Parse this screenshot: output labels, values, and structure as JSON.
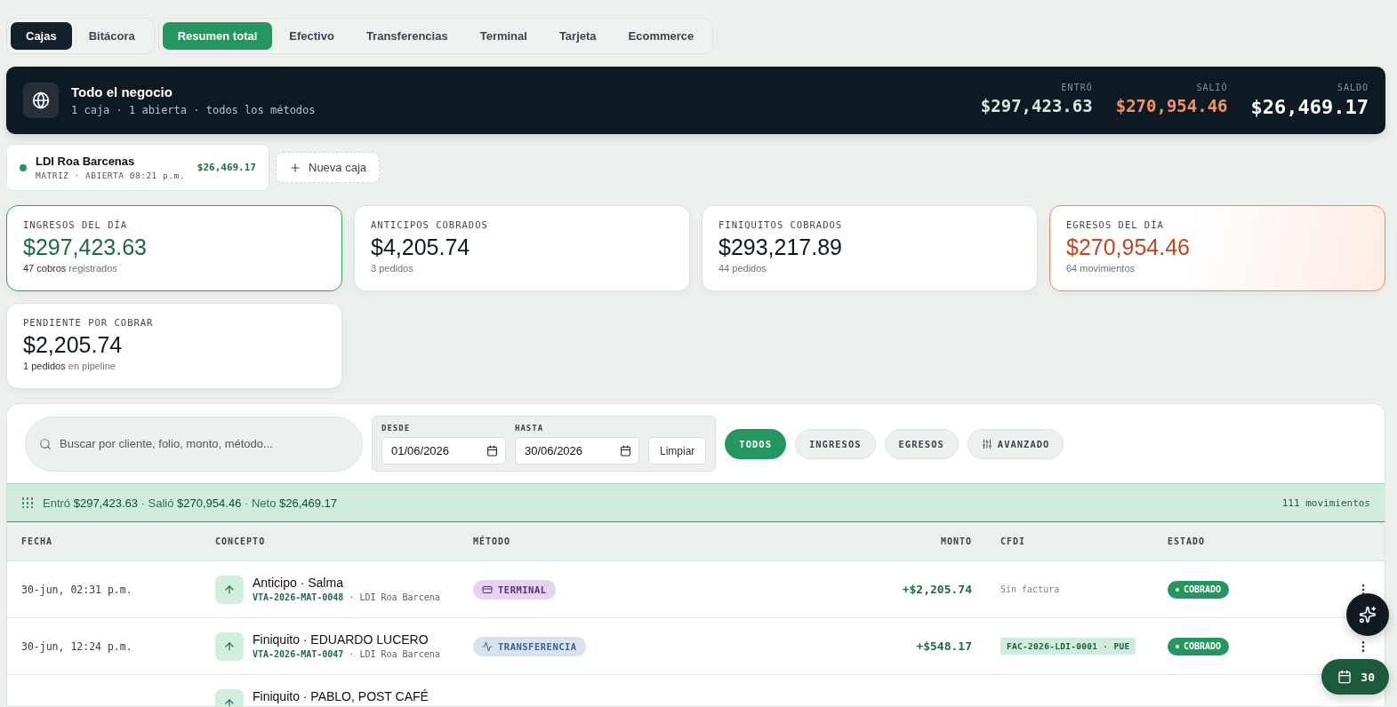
{
  "view_tabs": [
    {
      "label": "Cajas",
      "selected": true
    },
    {
      "label": "Bitácora",
      "selected": false
    }
  ],
  "method_tabs": [
    {
      "label": "Resumen total",
      "selected": true
    },
    {
      "label": "Efectivo",
      "selected": false
    },
    {
      "label": "Transferencias",
      "selected": false
    },
    {
      "label": "Terminal",
      "selected": false
    },
    {
      "label": "Tarjeta",
      "selected": false
    },
    {
      "label": "Ecommerce",
      "selected": false
    }
  ],
  "summary_banner": {
    "title": "Todo el negocio",
    "subtitle": "1 caja · 1 abierta · todos los métodos",
    "totals": [
      {
        "label": "ENTRÓ",
        "value": "$297,423.63",
        "kind": "in"
      },
      {
        "label": "SALIÓ",
        "value": "$270,954.46",
        "kind": "out"
      },
      {
        "label": "SALDO",
        "value": "$26,469.17",
        "kind": "balance"
      }
    ]
  },
  "registers": [
    {
      "name": "LDI Roa Barcenas",
      "meta": "MATRIZ · ABIERTA 08:21 p.m.",
      "amount": "$26,469.17",
      "open": true
    }
  ],
  "new_register_button": "Nueva caja",
  "stat_cards": [
    {
      "label": "INGRESOS DEL DÍA",
      "value": "$297,423.63",
      "detail": "**47 cobros** registrados",
      "kind": "income"
    },
    {
      "label": "ANTICIPOS COBRADOS",
      "value": "$4,205.74",
      "detail": "3 pedidos",
      "kind": "plain"
    },
    {
      "label": "FINIQUITOS COBRADOS",
      "value": "$293,217.89",
      "detail": "44 pedidos",
      "kind": "plain"
    },
    {
      "label": "EGRESOS DEL DÍA",
      "value": "$270,954.46",
      "detail": "64 movimientos",
      "kind": "expense"
    },
    {
      "label": "PENDIENTE POR COBRAR",
      "value": "$2,205.74",
      "detail": "**1 pedidos** en pipeline",
      "kind": "plain"
    }
  ],
  "filters": {
    "search_placeholder": "Buscar por cliente, folio, monto, método...",
    "date_from": {
      "label": "DESDE",
      "value": "01/06/2026"
    },
    "date_to": {
      "label": "HASTA",
      "value": "30/06/2026"
    },
    "clear_button": "Limpiar",
    "type_chips": [
      {
        "label": "TODOS",
        "selected": true,
        "kind": "plain"
      },
      {
        "label": "INGRESOS",
        "selected": false,
        "kind": "plain"
      },
      {
        "label": "EGRESOS",
        "selected": false,
        "kind": "plain"
      },
      {
        "label": "AVANZADO",
        "selected": false,
        "kind": "advanced"
      }
    ]
  },
  "totals_bar": {
    "text": "Entró **$297,423.63** · Salió **$270,954.46** · Neto **$26,469.17**",
    "count": "111 movimientos"
  },
  "table": {
    "columns": [
      "FECHA",
      "CONCEPTO",
      "MÉTODO",
      "MONTO",
      "CFDI",
      "ESTADO"
    ],
    "rows": [
      {
        "date": "30-jun, 02:31 p.m.",
        "kind": "income",
        "concept": "Anticipo · Salma",
        "folio": "VTA-2026-MAT-0048",
        "branch": "· LDI Roa Barcena",
        "method": {
          "label": "TERMINAL",
          "kind": "terminal"
        },
        "amount": "+$2,205.74",
        "cfdi": {
          "kind": "none",
          "text": "Sin factura"
        },
        "status": {
          "label": "COBRADO",
          "kind": "paid"
        }
      },
      {
        "date": "30-jun, 12:24 p.m.",
        "kind": "income",
        "concept": "Finiquito · EDUARDO LUCERO",
        "folio": "VTA-2026-MAT-0047",
        "branch": "· LDI Roa Barcena",
        "method": {
          "label": "TRANSFERENCIA",
          "kind": "transfer"
        },
        "amount": "+$548.17",
        "cfdi": {
          "kind": "invoice",
          "text": "FAC-2026-LDI-0001 · PUE"
        },
        "status": {
          "label": "COBRADO",
          "kind": "paid"
        }
      },
      {
        "kind": "income",
        "concept": "Finiquito · PABLO, POST CAFÉ"
      }
    ]
  },
  "floating": {
    "calendar_day": "30"
  }
}
